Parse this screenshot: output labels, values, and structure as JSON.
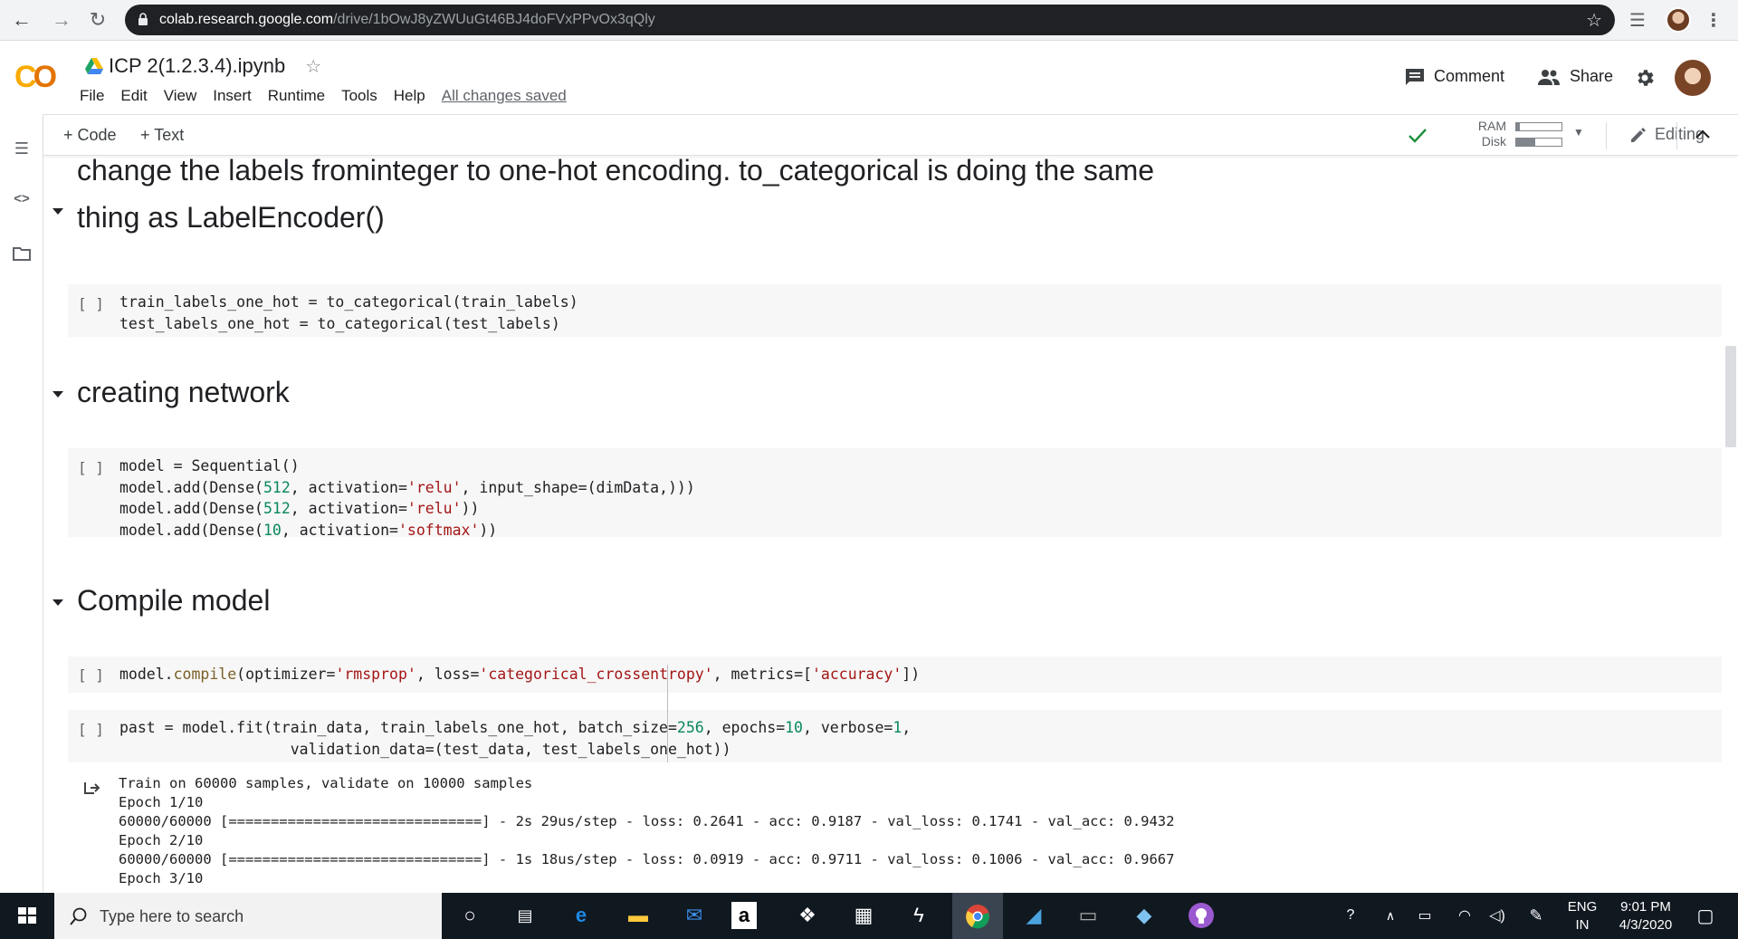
{
  "browser": {
    "url_host": "colab.research.google.com",
    "url_path": "/drive/1bOwJ8yZWUuGt46BJ4doFVxPPvOx3qQly"
  },
  "colab": {
    "logo": "CO",
    "title": "ICP 2(1.2.3.4).ipynb",
    "menu": [
      "File",
      "Edit",
      "View",
      "Insert",
      "Runtime",
      "Tools",
      "Help"
    ],
    "save_status": "All changes saved",
    "comment_label": "Comment",
    "share_label": "Share"
  },
  "toolbar": {
    "code_label": "+ Code",
    "text_label": "+ Text",
    "ram_label": "RAM",
    "disk_label": "Disk",
    "ram_level": 0.08,
    "disk_level": 0.42,
    "editing_label": "Editing"
  },
  "cells": {
    "md1_line1": "change the labels frominteger to one-hot encoding. to_categorical is doing the same",
    "md1_line2": "thing as LabelEncoder()",
    "code1_bracket": "[ ]",
    "md2": "creating network",
    "code2_bracket": "[ ]",
    "md3": "Compile model",
    "code3_bracket": "[ ]",
    "code4_bracket": "[ ]",
    "output": [
      "Train on 60000 samples, validate on 10000 samples",
      "Epoch 1/10",
      "60000/60000 [==============================] - 2s 29us/step - loss: 0.2641 - acc: 0.9187 - val_loss: 0.1741 - val_acc: 0.9432",
      "Epoch 2/10",
      "60000/60000 [==============================] - 1s 18us/step - loss: 0.0919 - acc: 0.9711 - val_loss: 0.1006 - val_acc: 0.9667",
      "Epoch 3/10"
    ]
  },
  "code_text": {
    "c1": [
      "train_labels_one_hot = to_categorical(train_labels)",
      "test_labels_one_hot = to_categorical(test_labels)"
    ],
    "c2": [
      "model = Sequential()",
      "model.add(Dense(",
      "512",
      ", activation=",
      "'relu'",
      ", input_shape=(dimData,)))",
      "model.add(Dense(",
      "512",
      ", activation=",
      "'relu'",
      "))",
      "model.add(Dense(",
      "10",
      ", activation=",
      "'softmax'",
      "))"
    ],
    "c3": [
      "model.",
      "compile",
      "(optimizer=",
      "'rmsprop'",
      ", loss=",
      "'categorical_crossentropy'",
      ", metrics=[",
      "'accuracy'",
      "])"
    ],
    "c4": [
      "past = model.fit(train_data, train_labels_one_hot, batch_size=",
      "256",
      ", epochs=",
      "10",
      ", verbose=",
      "1",
      ",",
      "validation_data=(test_data, test_labels_one_hot))"
    ]
  },
  "taskbar": {
    "search_placeholder": "Type here to search",
    "lang_line1": "ENG",
    "lang_line2": "IN",
    "time": "9:01 PM",
    "date": "4/3/2020"
  }
}
